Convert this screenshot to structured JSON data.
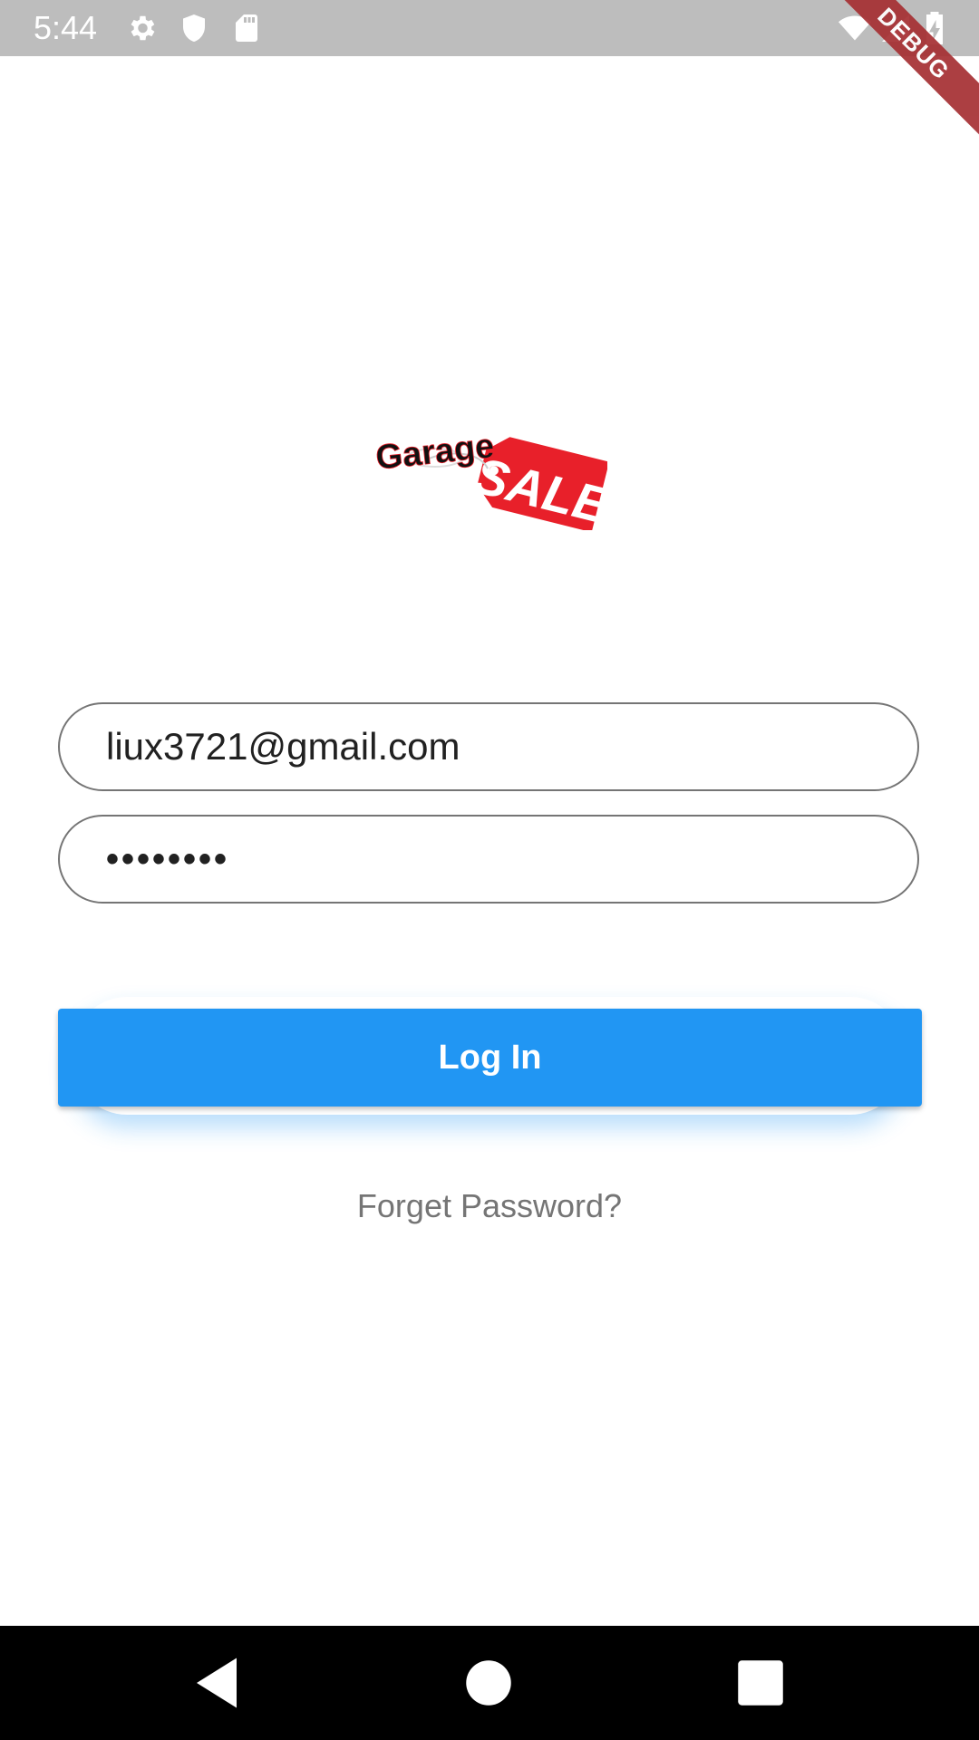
{
  "status_bar": {
    "time": "5:44",
    "icons": [
      "settings-icon",
      "shield-icon",
      "sd-card-icon",
      "wifi-icon",
      "signal-icon",
      "battery-charging-icon"
    ],
    "debug_banner": "DEBUG"
  },
  "logo": {
    "word": "Garage",
    "tag": "SALE"
  },
  "login_form": {
    "email_value": "liux3721@gmail.com",
    "password_value": "••••••••",
    "login_label": "Log In",
    "forget_password_label": "Forget Password?"
  },
  "nav_bar": {
    "buttons": [
      "back-icon",
      "home-icon",
      "recents-icon"
    ]
  },
  "colors": {
    "accent": "#2196f3",
    "status_bar": "#bdbdbd",
    "debug_ribbon": "#a62f33",
    "sale_tag": "#e8202a"
  }
}
